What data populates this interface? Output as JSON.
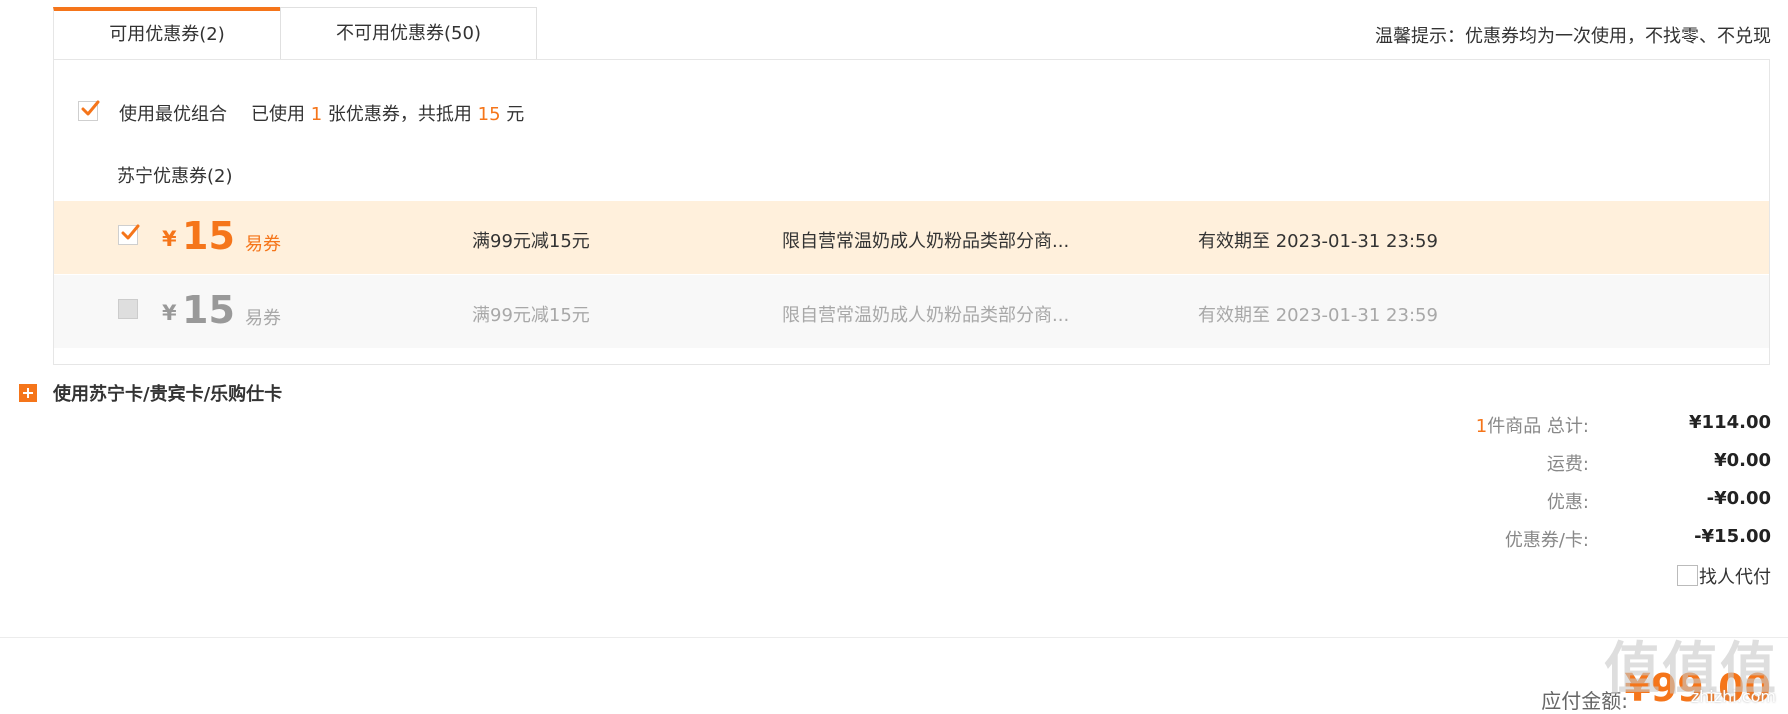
{
  "tabs": {
    "available": "可用优惠券(2)",
    "unavailable": "不可用优惠券(50)"
  },
  "tip": "温馨提示：优惠券均为一次使用，不找零、不兑现",
  "best": {
    "label": "使用最优组合",
    "used_prefix": "已使用",
    "used_count": "1",
    "used_mid": "张优惠券，共抵用",
    "offset_amount": "15",
    "offset_unit": "元",
    "checked": true
  },
  "group_title": "苏宁优惠券(2)",
  "coupons": [
    {
      "currency": "¥",
      "amount": "15",
      "type": "易券",
      "condition": "满99元减15元",
      "scope": "限自营常温奶成人奶粉品类部分商...",
      "validity": "有效期至 2023-01-31 23:59",
      "checked": true,
      "enabled": true
    },
    {
      "currency": "¥",
      "amount": "15",
      "type": "易券",
      "condition": "满99元减15元",
      "scope": "限自营常温奶成人奶粉品类部分商...",
      "validity": "有效期至 2023-01-31 23:59",
      "checked": false,
      "enabled": false
    }
  ],
  "card_option": "使用苏宁卡/贵宾卡/乐购仕卡",
  "summary": {
    "items_count": "1",
    "items_label": "件商品 总计:",
    "items_total": "¥114.00",
    "shipping_label": "运费:",
    "shipping": "¥0.00",
    "discount_label": "优惠:",
    "discount": "-¥0.00",
    "coupon_label": "优惠券/卡:",
    "coupon": "-¥15.00",
    "pay_for_me": "找人代付"
  },
  "due": {
    "label": "应付金额:",
    "amount": "¥99.00"
  },
  "watermark": {
    "logo": "值值值",
    "url": "zhizhi.com"
  },
  "colors": {
    "accent": "#f5751a",
    "selected_row": "#fff0dc",
    "disabled_row": "#f8f8f8"
  }
}
